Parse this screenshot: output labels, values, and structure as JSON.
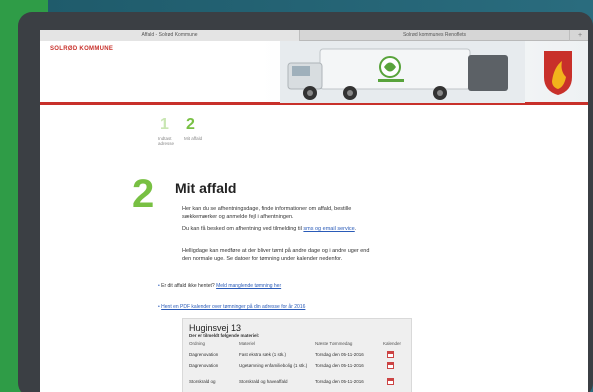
{
  "browser": {
    "tabs": [
      {
        "label": "Affald - Solrød Kommune"
      },
      {
        "label": "Solrød kommunes Renoflets"
      }
    ],
    "new_tab_symbol": "+"
  },
  "header": {
    "logo_text": "SOLRØD KOMMUNE",
    "brand_color": "#c8302a"
  },
  "steps": [
    {
      "number": "1",
      "label": "Indtast adresse"
    },
    {
      "number": "2",
      "label": "Mit affald"
    }
  ],
  "main": {
    "step_number": "2",
    "title": "Mit affald",
    "intro": "Her kan du se afhentningsdage, finde informationer om affald, bestille sækkemærker og anmelde fejl i afhentningen.",
    "notify_prefix": "Du kan få besked om afhentning ved tilmelding til ",
    "notify_link": "sms og email service",
    "notify_suffix": ".",
    "holiday_note": "Helligdage kan medføre at der bliver tømt på andre dage og i andre uger end den normale uge. Se datoer for tømning under kalender nedenfor.",
    "bullet1_prefix": "Er dit affald ikke hentet? ",
    "bullet1_link": "Meld manglende tømning her",
    "bullet2_link": "Hent en PDF kalender over tømninger på din adresse for år 2016"
  },
  "table": {
    "address": "Huginsvej 13",
    "subtitle": "Der er tilmeldt følgende materiel:",
    "columns": [
      "Ordning",
      "Materiel",
      "Næste Tømmedag",
      "Kalender"
    ],
    "rows": [
      {
        "ordning": "Dagrenovation",
        "materiel": "Fast ekstra sæk (1 stk.)",
        "next": "Torsdag den 05-11-2016"
      },
      {
        "ordning": "Dagrenovation",
        "materiel": "Ugetømning enfamiliebolig (1 stk.)",
        "next": "Torsdag den 05-11-2016"
      },
      {
        "ordning": "Storskrald og",
        "materiel": "Storskrald og haveaffald",
        "next": "Torsdag den 05-11-2016"
      }
    ]
  },
  "colors": {
    "accent_green": "#78c043",
    "link_blue": "#2a5bb8"
  }
}
